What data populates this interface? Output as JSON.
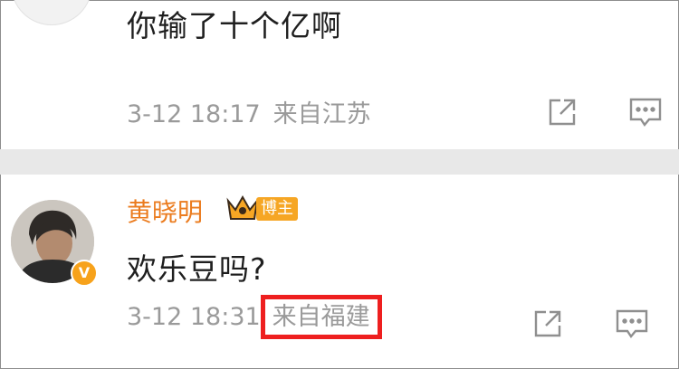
{
  "comments": [
    {
      "text": "你输了十个亿啊",
      "time": "3-12 18:17",
      "location": "来自江苏"
    },
    {
      "username": "黄晓明",
      "badge": "博主",
      "verified_mark": "V",
      "text": "欢乐豆吗?",
      "time": "3-12 18:31",
      "location": "来自福建"
    }
  ],
  "colors": {
    "username": "#eb7c1f",
    "badge_bg": "#f6a624",
    "highlight": "#ee1f1f",
    "meta_text": "#9a9a9a"
  },
  "icons": [
    "share-icon",
    "comment-icon",
    "crown-icon",
    "verified-icon"
  ]
}
